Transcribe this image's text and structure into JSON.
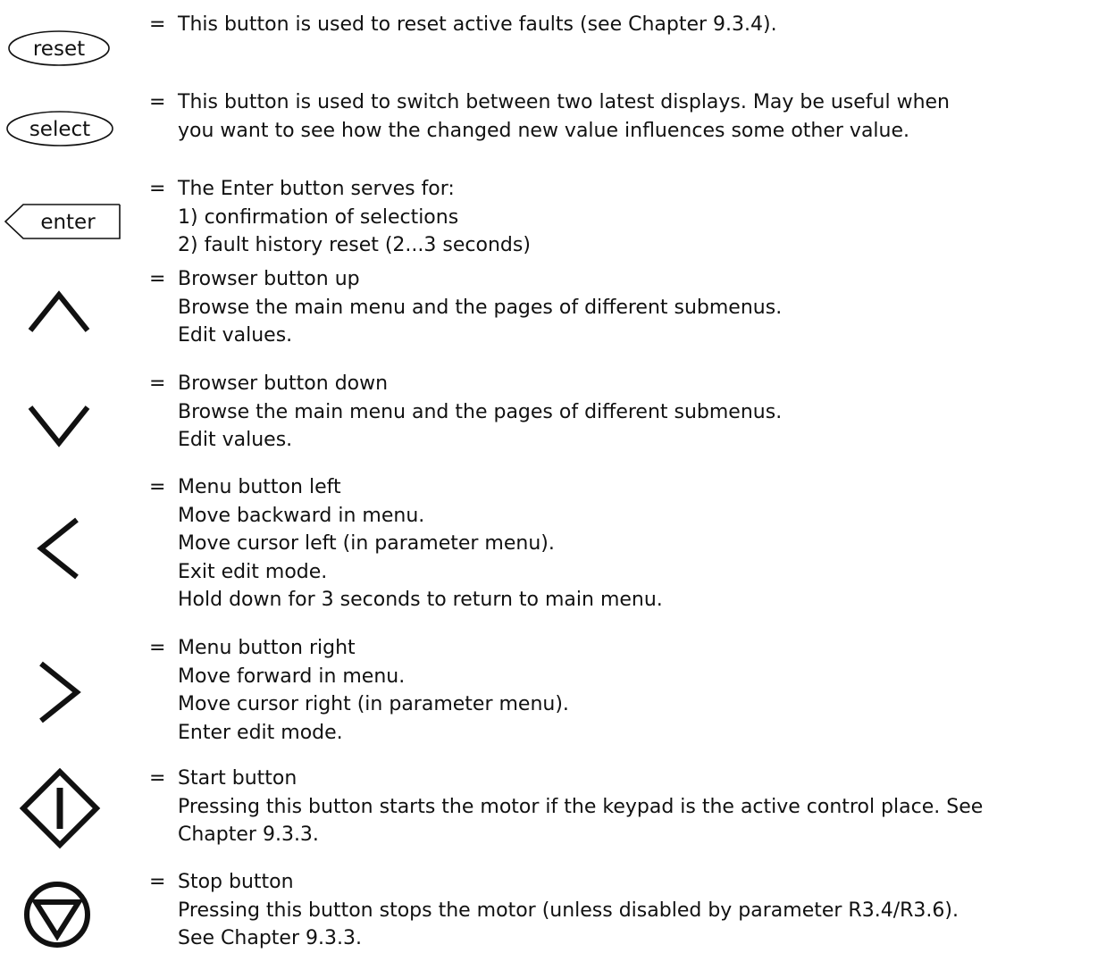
{
  "keys": [
    {
      "id": "reset",
      "icon": "reset-button-icon",
      "icon_label": "reset",
      "lines": [
        "This button is used to reset active faults (see Chapter 9.3.4)."
      ]
    },
    {
      "id": "select",
      "icon": "select-button-icon",
      "icon_label": "select",
      "lines": [
        "This button is used to switch between two latest displays. May be useful when",
        "you want to see how the changed new value influences some other value."
      ]
    },
    {
      "id": "enter",
      "icon": "enter-button-icon",
      "icon_label": "enter",
      "lines": [
        "The Enter button serves for:",
        "1) confirmation of selections",
        "2) fault history reset (2...3 seconds)"
      ]
    },
    {
      "id": "up",
      "icon": "chevron-up-icon",
      "lines": [
        "Browser button up",
        "Browse the main menu and the pages of different submenus.",
        "Edit values."
      ]
    },
    {
      "id": "down",
      "icon": "chevron-down-icon",
      "lines": [
        "Browser button down",
        "Browse the main menu and the pages of different submenus.",
        "Edit values."
      ]
    },
    {
      "id": "left",
      "icon": "chevron-left-icon",
      "lines": [
        "Menu button left",
        "Move backward in menu.",
        "Move cursor left (in parameter menu).",
        "Exit edit mode.",
        "Hold down for 3 seconds to return to main menu."
      ]
    },
    {
      "id": "right",
      "icon": "chevron-right-icon",
      "lines": [
        "Menu button right",
        "Move forward in menu.",
        "Move cursor right (in parameter menu).",
        "Enter edit mode."
      ]
    },
    {
      "id": "start",
      "icon": "start-button-icon",
      "lines": [
        "Start button",
        "Pressing this button starts the motor if the keypad is the active control place. See",
        "Chapter 9.3.3."
      ]
    },
    {
      "id": "stop",
      "icon": "stop-button-icon",
      "lines": [
        "Stop button",
        "Pressing this button stops the motor (unless disabled by parameter R3.4/R3.6).",
        "See Chapter 9.3.3."
      ]
    }
  ],
  "equals_sign": "="
}
